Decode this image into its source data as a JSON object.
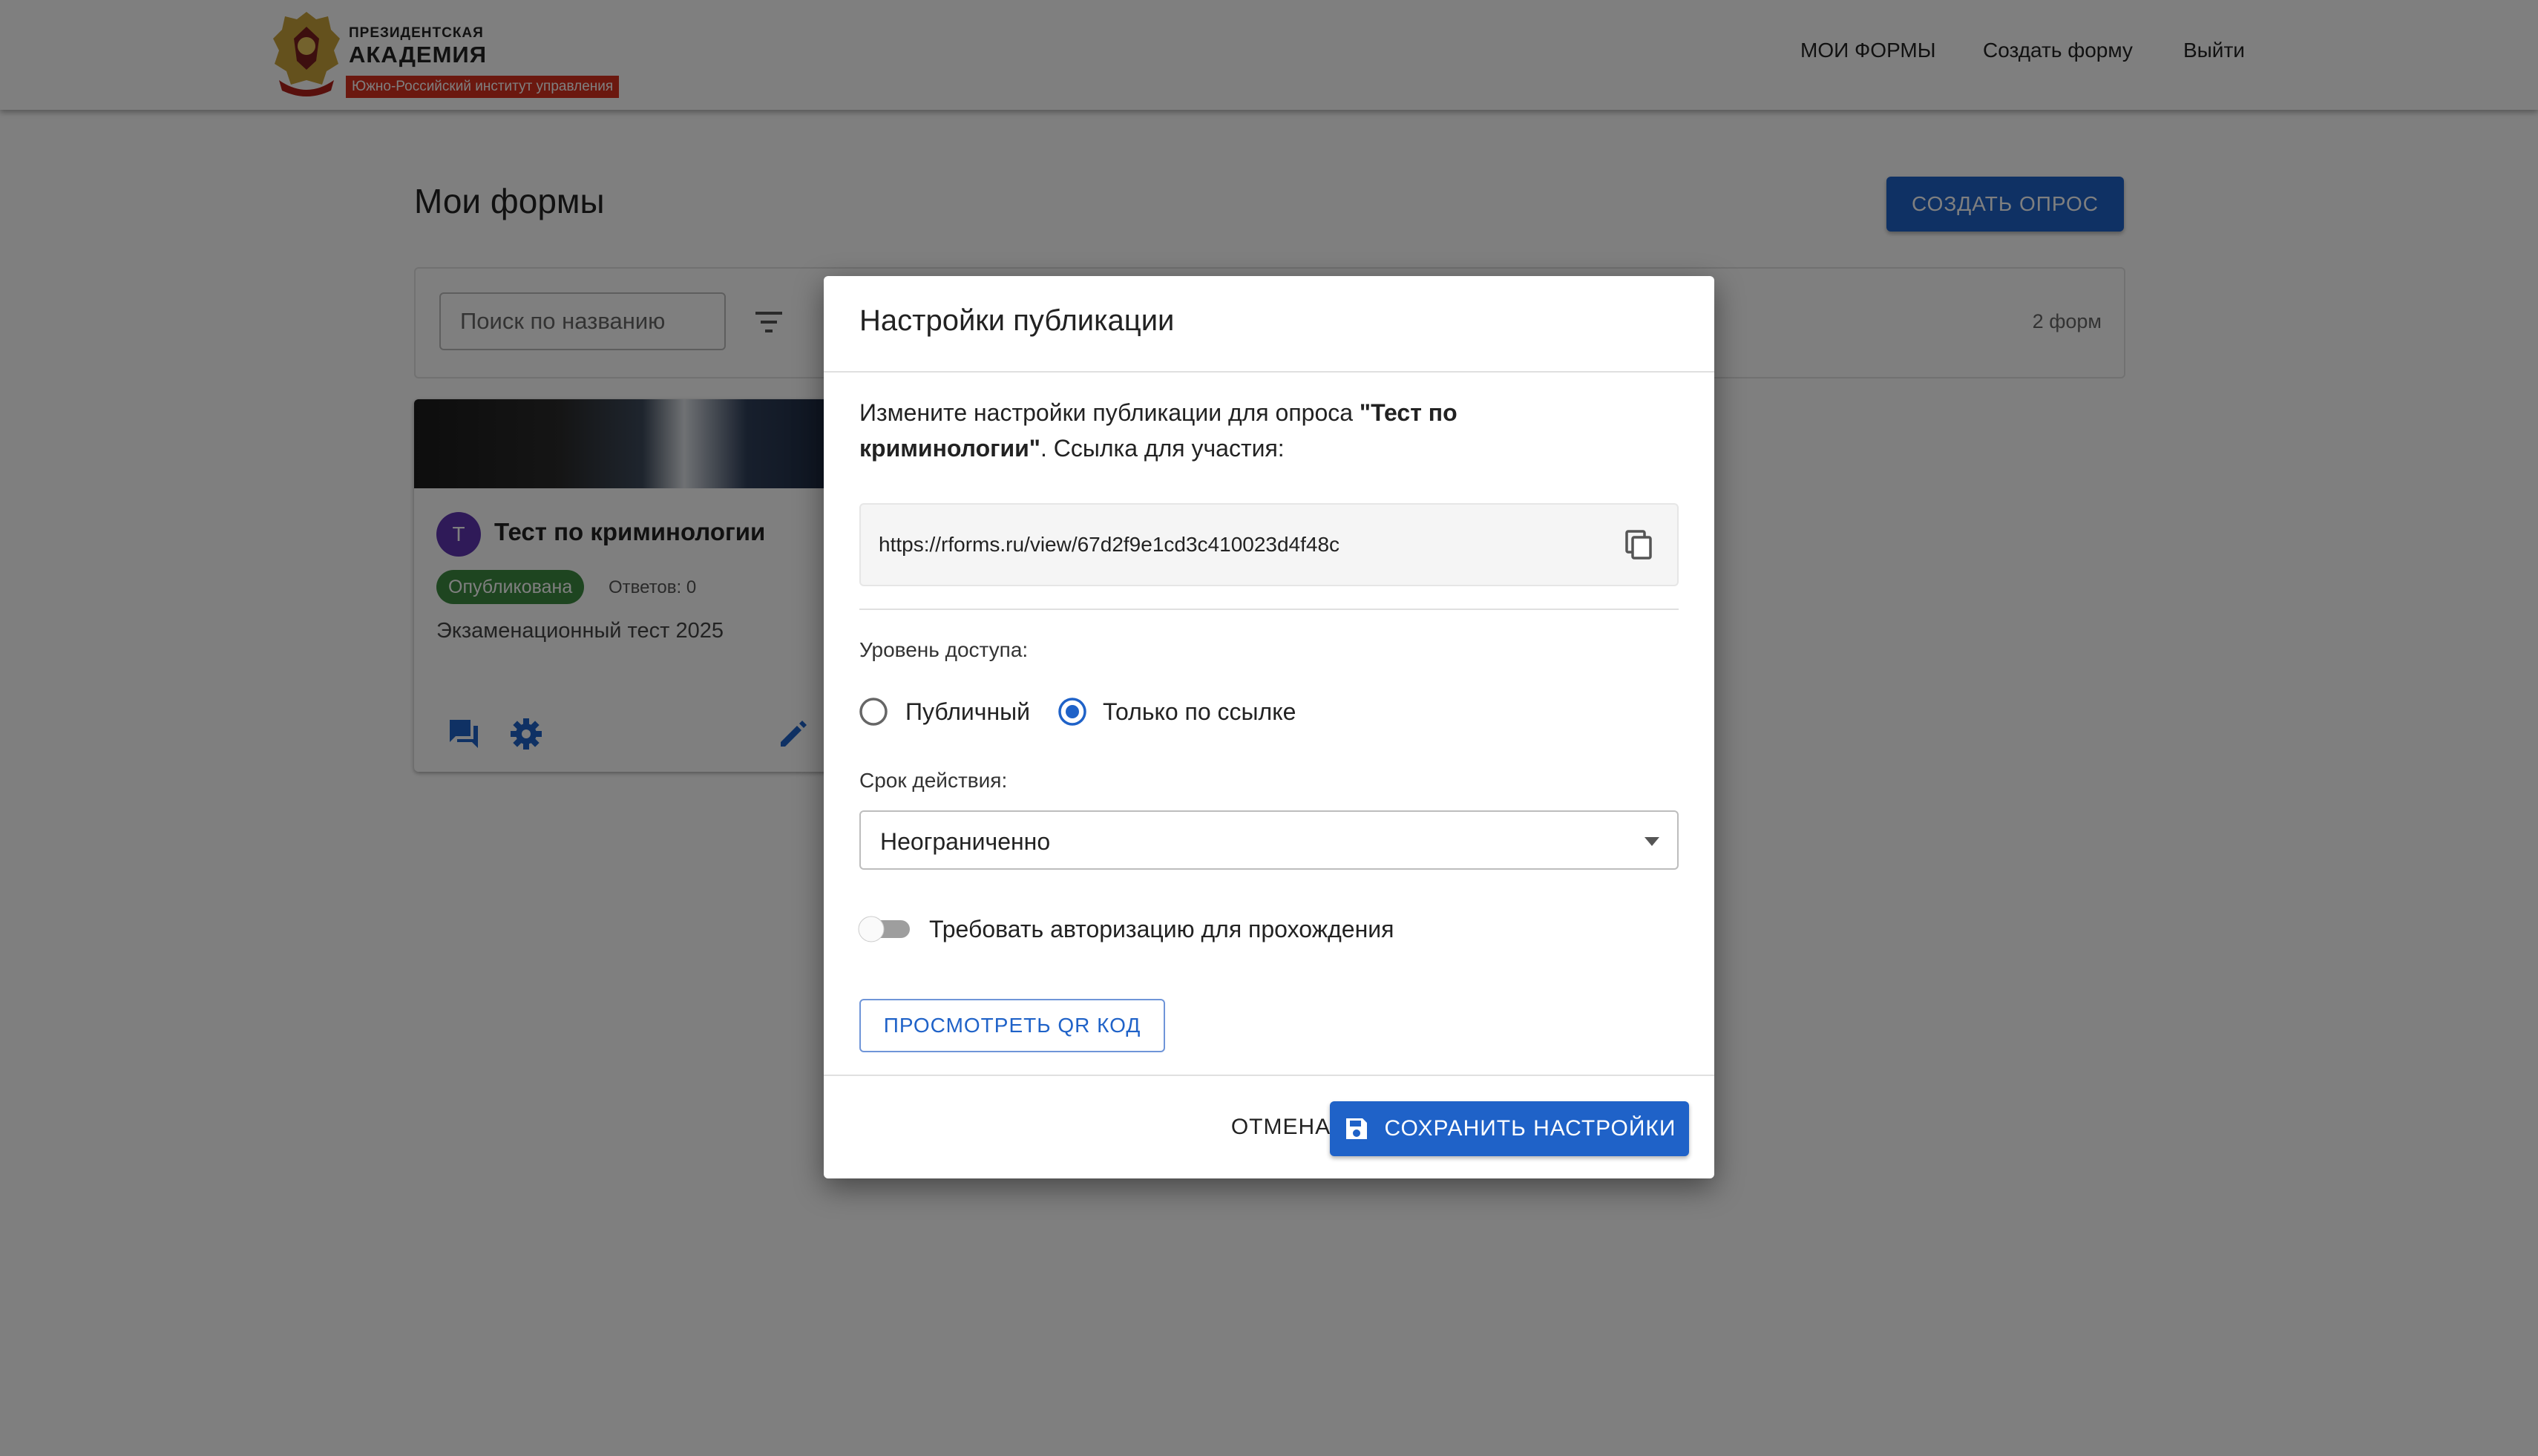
{
  "header": {
    "logo_top": "ПРЕЗИДЕНТСКАЯ",
    "logo_main": "АКАДЕМИЯ",
    "logo_sub": "Южно-Российский институт управления",
    "nav": [
      "МОИ ФОРМЫ",
      "Создать форму",
      "Выйти"
    ]
  },
  "page": {
    "title": "Мои формы",
    "create_button": "СОЗДАТЬ ОПРОС",
    "search_placeholder": "Поиск по названию",
    "count": "2 форм"
  },
  "card": {
    "avatar_letter": "Т",
    "title": "Тест по криминологии",
    "status": "Опубликована",
    "answers": "Ответов: 0",
    "description": "Экзаменационный тест 2025",
    "status_color": "#3d8b40",
    "avatar_color": "#5e35b1"
  },
  "modal": {
    "title": "Настройки публикации",
    "desc_prefix": "Измените настройки публикации для опроса ",
    "desc_bold": "\"Тест по криминологии\"",
    "desc_suffix": ". Ссылка для участия:",
    "url": "https://rforms.ru/view/67d2f9e1cd3c410023d4f48c",
    "access_label": "Уровень доступа:",
    "access_options": [
      {
        "label": "Публичный",
        "selected": false
      },
      {
        "label": "Только по ссылке",
        "selected": true
      }
    ],
    "expiry_label": "Срок действия:",
    "expiry_value": "Неограниченно",
    "require_auth_label": "Требовать авторизацию для прохождения",
    "require_auth_on": false,
    "qr_button": "ПРОСМОТРЕТЬ QR КОД",
    "cancel_button": "ОТМЕНА",
    "save_button": "СОХРАНИТЬ НАСТРОЙКИ"
  },
  "colors": {
    "accent": "#1f62c8",
    "overlay": "rgba(0,0,0,0.5)"
  },
  "icons": [
    "filter-icon",
    "comments-icon",
    "gear-icon",
    "edit-pencil-icon",
    "copy-icon",
    "chevron-down-icon",
    "save-icon"
  ]
}
